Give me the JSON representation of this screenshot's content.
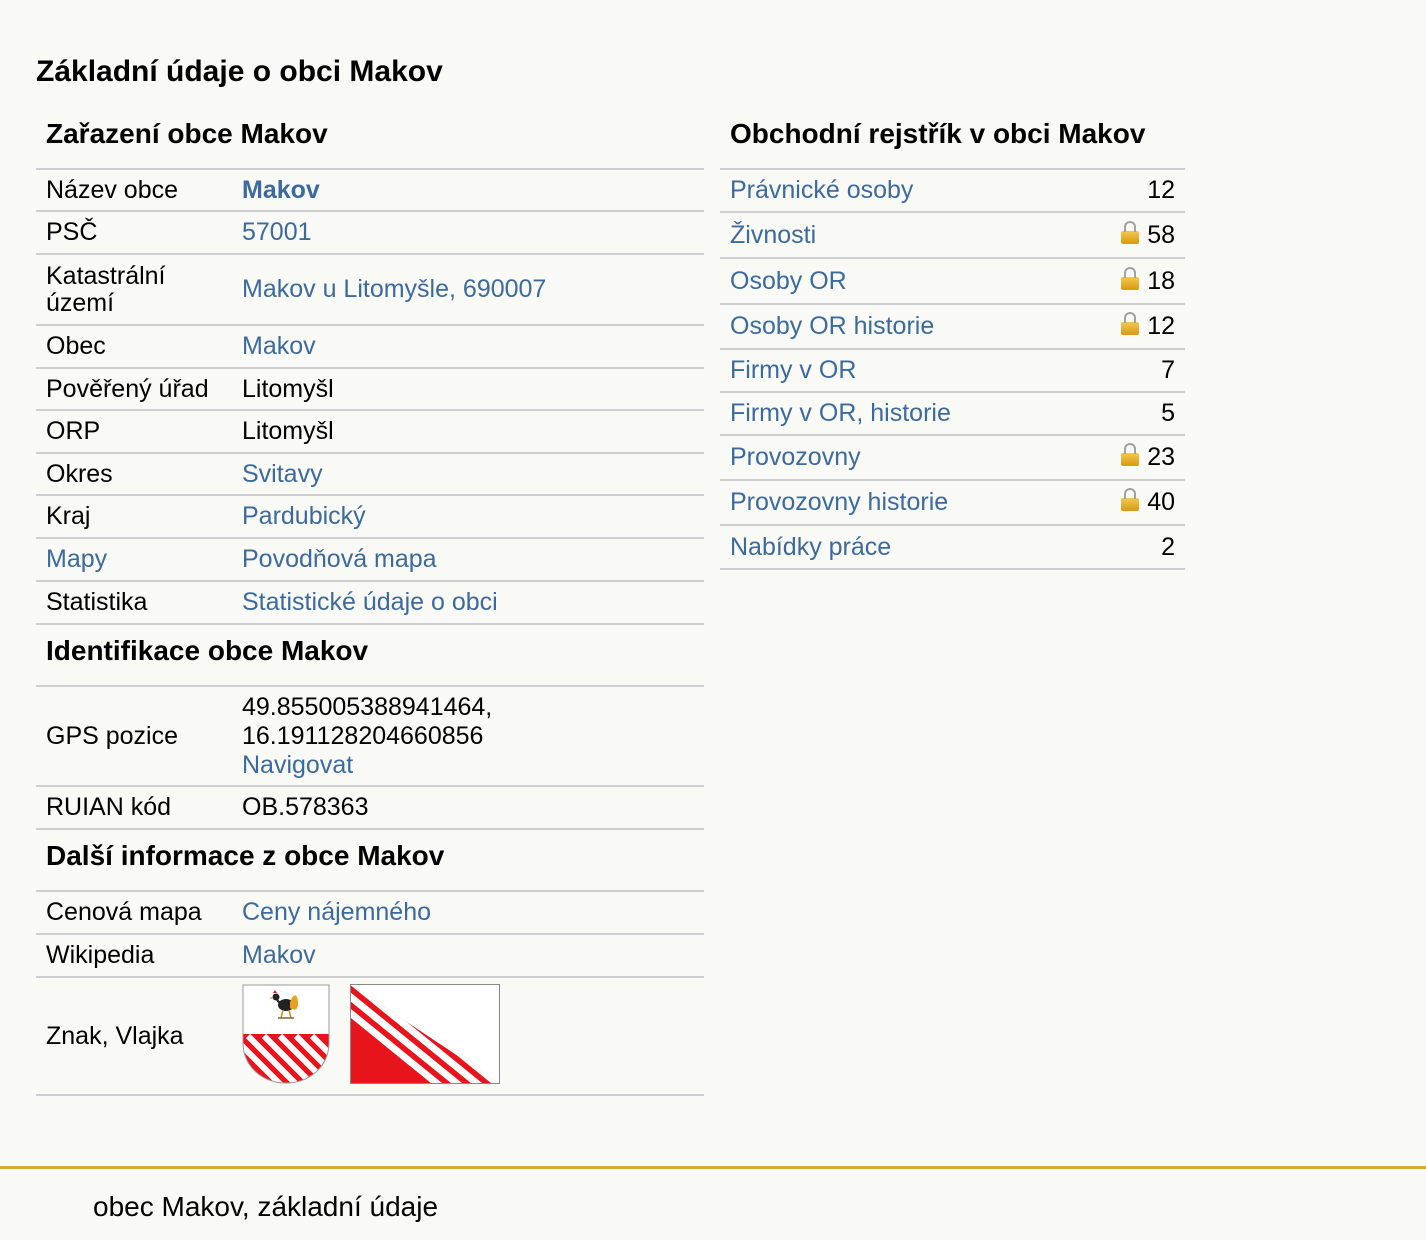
{
  "page_title": "Základní údaje o obci Makov",
  "zarazeni": {
    "heading": "Zařazení obce Makov",
    "rows": [
      {
        "label": "Název obce",
        "value": "Makov"
      },
      {
        "label": "PSČ",
        "value": "57001"
      },
      {
        "label": "Katastrální území",
        "value": "Makov u Litomyšle, 690007"
      },
      {
        "label": "Obec",
        "value": "Makov"
      },
      {
        "label": "Pověřený úřad",
        "value": "Litomyšl"
      },
      {
        "label": "ORP",
        "value": "Litomyšl"
      },
      {
        "label": "Okres",
        "value": "Svitavy"
      },
      {
        "label": "Kraj",
        "value": "Pardubický"
      },
      {
        "label": "Mapy",
        "value": "Povodňová mapa"
      },
      {
        "label": "Statistika",
        "value": "Statistické údaje o obci"
      }
    ]
  },
  "identifikace": {
    "heading": "Identifikace obce Makov",
    "gps_label": "GPS pozice",
    "gps_lat": "49.855005388941464,",
    "gps_lon": "16.191128204660856",
    "gps_link": "Navigovat",
    "ruian_label": "RUIAN kód",
    "ruian_value": "OB.578363"
  },
  "dalsi": {
    "heading": "Další informace z obce Makov",
    "cenova_label": "Cenová mapa",
    "cenova_value": "Ceny nájemného",
    "wiki_label": "Wikipedia",
    "wiki_value": "Makov",
    "znak_label": "Znak, Vlajka"
  },
  "rejstrik": {
    "heading": "Obchodní rejstřík v obci Makov",
    "rows": [
      {
        "label": "Právnické osoby",
        "value": "12",
        "locked": false
      },
      {
        "label": "Živnosti",
        "value": "58",
        "locked": true
      },
      {
        "label": "Osoby OR",
        "value": "18",
        "locked": true
      },
      {
        "label": "Osoby OR historie",
        "value": "12",
        "locked": true
      },
      {
        "label": "Firmy v OR",
        "value": "7",
        "locked": false
      },
      {
        "label": "Firmy v OR, historie",
        "value": "5",
        "locked": false
      },
      {
        "label": "Provozovny",
        "value": "23",
        "locked": true
      },
      {
        "label": "Provozovny historie",
        "value": "40",
        "locked": true
      },
      {
        "label": "Nabídky práce",
        "value": "2",
        "locked": false
      }
    ]
  },
  "footer": {
    "text": "obec Makov, základní údaje"
  },
  "colors": {
    "link": "#3b6a9e",
    "accent_line": "#d8a92e",
    "flag_red": "#e8141c"
  }
}
